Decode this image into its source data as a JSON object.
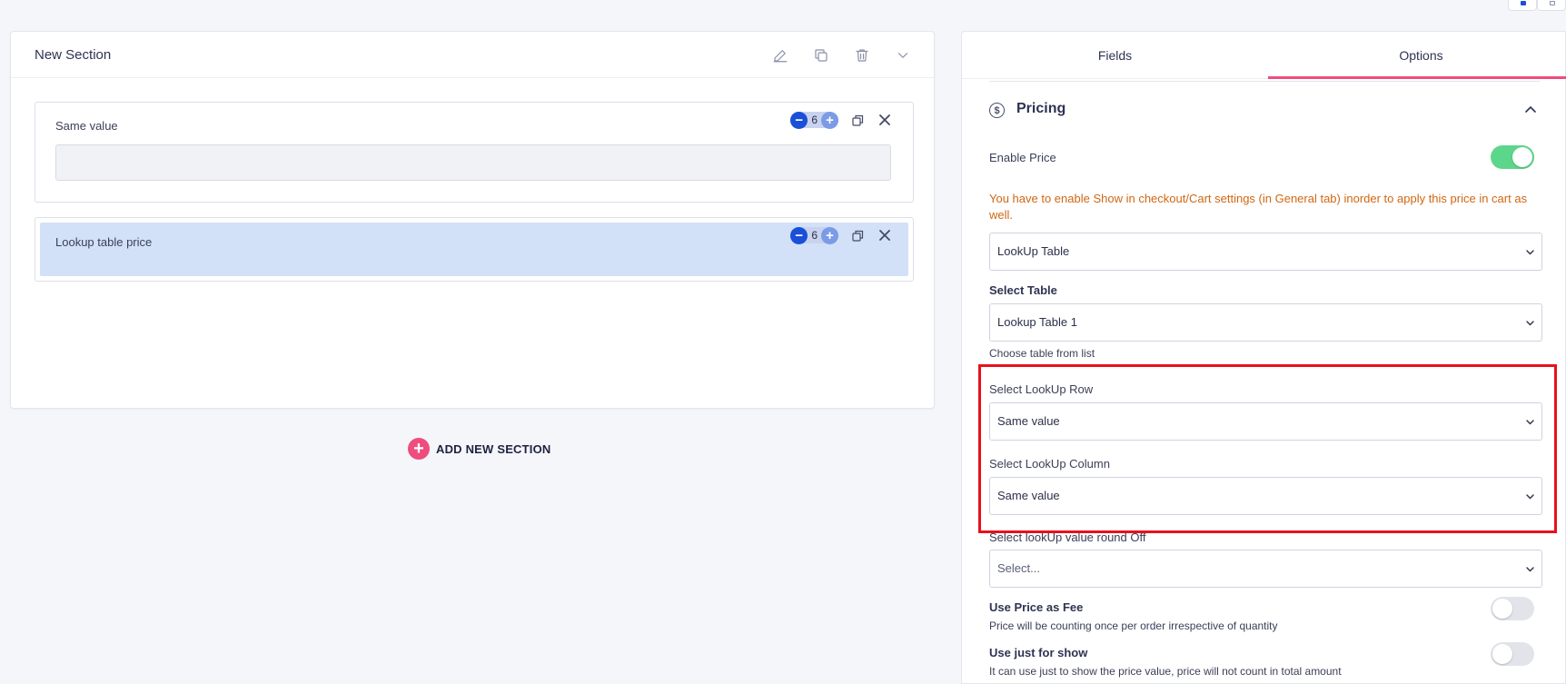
{
  "section": {
    "title": "New Section",
    "icons": [
      "edit-icon",
      "duplicate-icon",
      "trash-icon",
      "chevron-down-icon"
    ]
  },
  "fields": [
    {
      "label": "Same value",
      "columns": "6",
      "input_value": ""
    },
    {
      "label": "Lookup table price",
      "columns": "6"
    }
  ],
  "add_section": {
    "label": "ADD NEW SECTION"
  },
  "panel": {
    "tabs": [
      {
        "label": "Fields",
        "active": false
      },
      {
        "label": "Options",
        "active": true
      }
    ],
    "pricing": {
      "title": "Pricing",
      "enable_price_label": "Enable Price",
      "enable_price_on": true,
      "warning": "You have to enable Show in checkout/Cart settings (in General tab) inorder to apply this price in cart as well.",
      "price_type": "LookUp Table",
      "select_table_label": "Select Table",
      "select_table_value": "Lookup Table 1",
      "select_table_help": "Choose table from list",
      "row_label": "Select LookUp Row",
      "row_value": "Same value",
      "column_label": "Select LookUp Column",
      "column_value": "Same value",
      "roundoff_label": "Select lookUp value round Off",
      "roundoff_placeholder": "Select...",
      "fee_label": "Use Price as Fee",
      "fee_help": "Price will be counting once per order irrespective of quantity",
      "fee_on": false,
      "show_label": "Use just for show",
      "show_help": "It can use just to show the price value, price will not count in total amount",
      "show_on": false
    }
  },
  "colors": {
    "accent": "#ee4d7e",
    "toggle_on": "#5cd68a",
    "warning": "#d06713",
    "highlight_box": "#e8111c",
    "selected_field": "#d2e1f7",
    "primary_blue": "#1a4fd8"
  }
}
